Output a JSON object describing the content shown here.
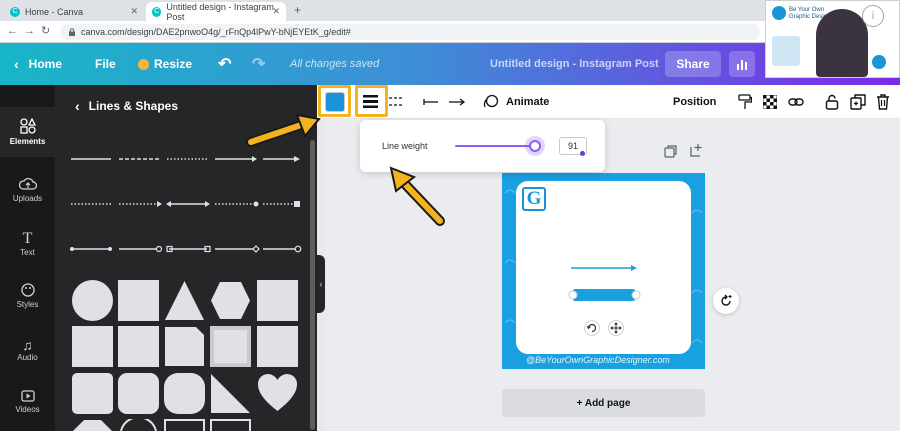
{
  "browser": {
    "tabs": [
      {
        "label": "Home - Canva",
        "active": false
      },
      {
        "label": "Untitled design - Instagram Post",
        "active": true
      }
    ],
    "new_tab": "+",
    "url": "canva.com/design/DAE2pnwoO4g/_rFnQp4lPwY-bNjEYEtK_g/edit#"
  },
  "header": {
    "home": "Home",
    "file": "File",
    "resize": "Resize",
    "saved_status": "All changes saved",
    "design_title": "Untitled design - Instagram Post",
    "share": "Share"
  },
  "siderail": {
    "items": [
      {
        "label": "Elements",
        "icon": "shapes-icon"
      },
      {
        "label": "Uploads",
        "icon": "cloud-upload-icon"
      },
      {
        "label": "Text",
        "icon": "text-icon"
      },
      {
        "label": "Styles",
        "icon": "palette-icon"
      },
      {
        "label": "Audio",
        "icon": "music-note-icon"
      },
      {
        "label": "Videos",
        "icon": "video-icon"
      }
    ]
  },
  "panel": {
    "title": "Lines & Shapes"
  },
  "toolbar": {
    "animate": "Animate",
    "position": "Position"
  },
  "line_weight": {
    "label": "Line weight",
    "value": "91",
    "fraction": 0.91
  },
  "design": {
    "logo_letter": "G",
    "watermark": "@BeYourOwnGraphicDesigner.com",
    "add_page": "+ Add page"
  },
  "webcam": {
    "brand_line1": "Be Your Own",
    "brand_line2": "Graphic Designer.com"
  },
  "colors": {
    "accent": "#19a0e0",
    "highlight": "#f3b31f",
    "slider": "#8b5cf6"
  }
}
